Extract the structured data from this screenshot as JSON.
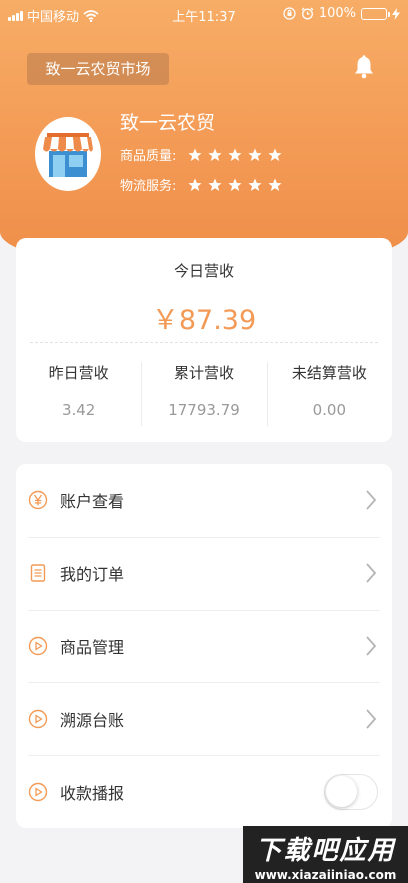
{
  "status_bar": {
    "carrier": "中国移动",
    "time": "上午11:37",
    "battery_percent": "100%",
    "battery_level": 1.0
  },
  "header": {
    "market_name": "致一云农贸市场",
    "shop_name": "致一云农贸",
    "ratings": [
      {
        "label": "商品质量:",
        "stars": 5
      },
      {
        "label": "物流服务:",
        "stars": 5
      }
    ]
  },
  "revenue": {
    "today_label": "今日营收",
    "today_value": "￥87.39",
    "stats": [
      {
        "label": "昨日营收",
        "value": "3.42"
      },
      {
        "label": "累计营收",
        "value": "17793.79"
      },
      {
        "label": "未结算营收",
        "value": "0.00"
      }
    ]
  },
  "menu": {
    "items": [
      {
        "label": "账户查看",
        "icon": "yen-circle-icon",
        "control": "chevron"
      },
      {
        "label": "我的订单",
        "icon": "order-list-icon",
        "control": "chevron"
      },
      {
        "label": "商品管理",
        "icon": "play-circle-icon",
        "control": "chevron"
      },
      {
        "label": "溯源台账",
        "icon": "play-circle-icon",
        "control": "chevron"
      },
      {
        "label": "收款播报",
        "icon": "play-circle-icon",
        "control": "toggle",
        "toggle_on": false
      }
    ]
  },
  "watermark": {
    "title": "下载吧应用",
    "url": "www.xiazaiiniao.com"
  },
  "colors": {
    "accent": "#f29a56",
    "header_gradient_top": "#f7ad66",
    "header_gradient_bottom": "#ee8d48",
    "battery_fill": "#5ad05a"
  }
}
